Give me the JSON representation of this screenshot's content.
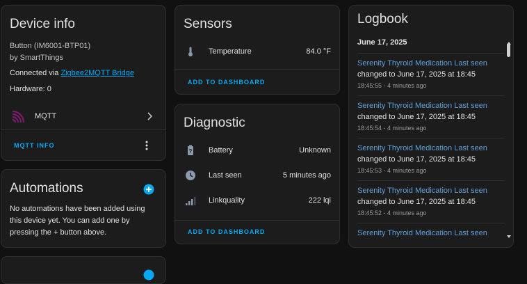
{
  "device_info": {
    "title": "Device info",
    "model": "Button (IM6001-BTP01)",
    "manufacturer": "by SmartThings",
    "connected_prefix": "Connected via ",
    "connected_link": "Zigbee2MQTT Bridge",
    "hardware": "Hardware: 0",
    "integration": "MQTT",
    "mqtt_info_button": "MQTT INFO"
  },
  "automations": {
    "title": "Automations",
    "empty_text": "No automations have been added using this device yet. You can add one by pressing the + button above."
  },
  "sensors": {
    "title": "Sensors",
    "items": [
      {
        "icon": "thermometer-icon",
        "label": "Temperature",
        "value": "84.0 °F"
      }
    ],
    "add_button": "ADD TO DASHBOARD"
  },
  "diagnostic": {
    "title": "Diagnostic",
    "items": [
      {
        "icon": "battery-unknown-icon",
        "label": "Battery",
        "value": "Unknown"
      },
      {
        "icon": "clock-icon",
        "label": "Last seen",
        "value": "5 minutes ago"
      },
      {
        "icon": "signal-icon",
        "label": "Linkquality",
        "value": "222 lqi"
      }
    ],
    "add_button": "ADD TO DASHBOARD"
  },
  "logbook": {
    "title": "Logbook",
    "date": "June 17, 2025",
    "entries": [
      {
        "name": "Serenity Thyroid Medication Last seen",
        "message": "changed to June 17, 2025 at 18:45",
        "time": "18:45:55 - 4 minutes ago"
      },
      {
        "name": "Serenity Thyroid Medication Last seen",
        "message": "changed to June 17, 2025 at 18:45",
        "time": "18:45:54 - 4 minutes ago"
      },
      {
        "name": "Serenity Thyroid Medication Last seen",
        "message": "changed to June 17, 2025 at 18:45",
        "time": "18:45:53 - 4 minutes ago"
      },
      {
        "name": "Serenity Thyroid Medication Last seen",
        "message": "changed to June 17, 2025 at 18:45",
        "time": "18:45:52 - 4 minutes ago"
      },
      {
        "name": "Serenity Thyroid Medication Last seen",
        "message": "",
        "time": ""
      }
    ]
  },
  "colors": {
    "accent": "#03a9f4",
    "card_bg": "#1c1c1c",
    "page_bg": "#111111",
    "mqtt_icon": "#7a1b6e",
    "icon_grey": "#8a9bb0"
  }
}
